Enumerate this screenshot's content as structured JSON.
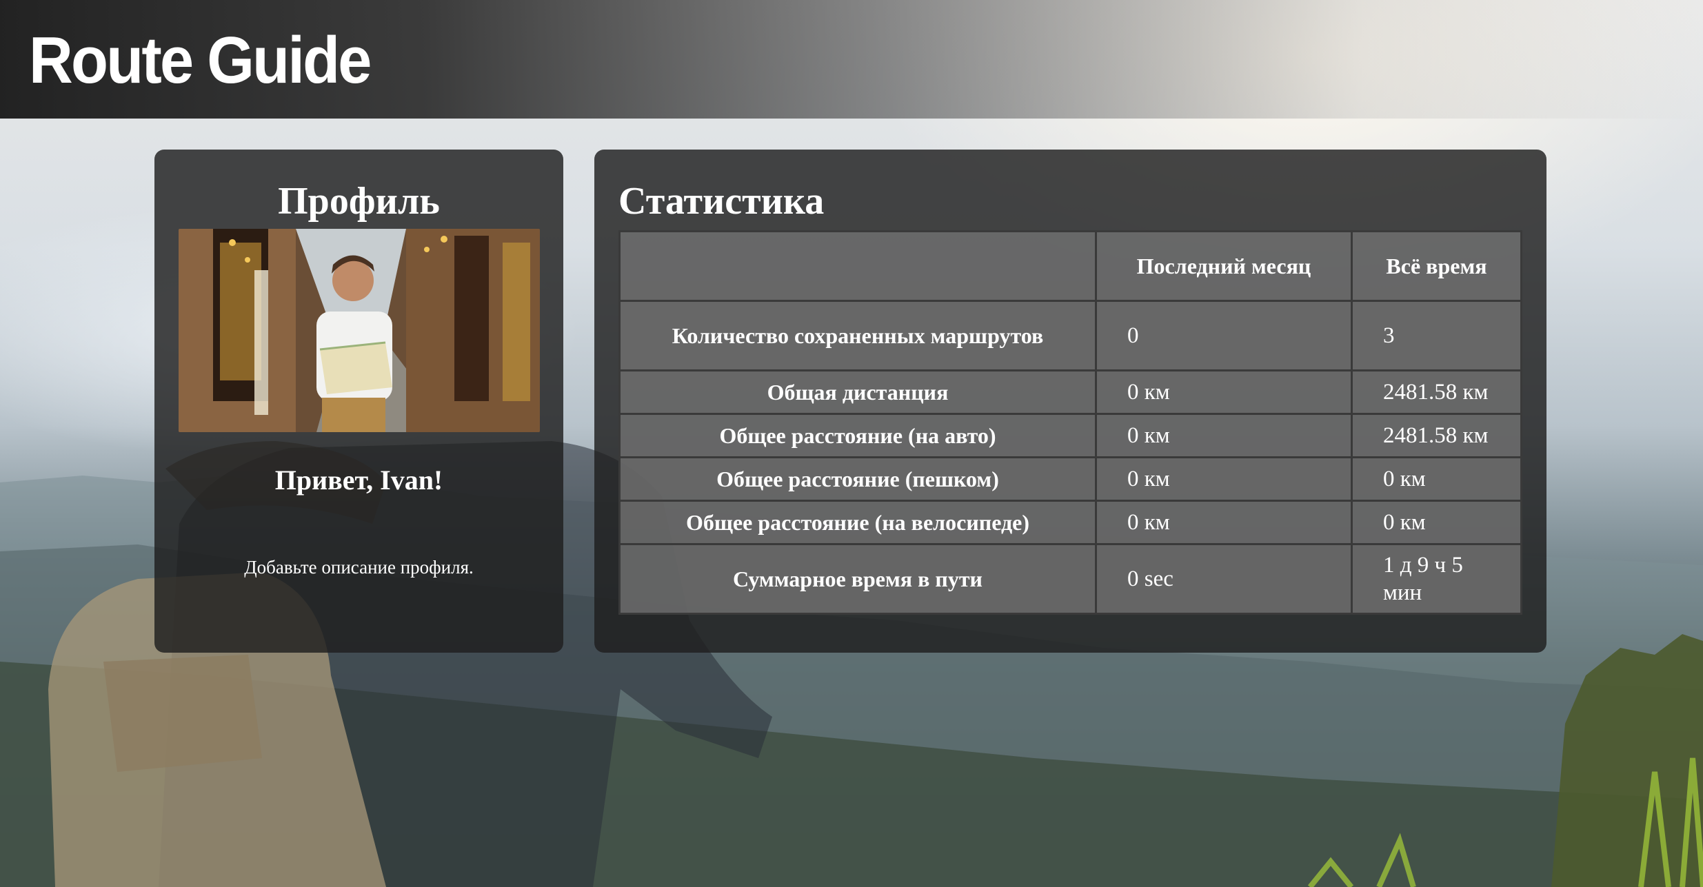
{
  "header": {
    "brand": "Route Guide"
  },
  "profile": {
    "title": "Профиль",
    "greeting": "Привет, Ivan!",
    "description": "Добавьте описание профиля."
  },
  "stats": {
    "title": "Статистика",
    "columns": [
      "",
      "Последний месяц",
      "Всё время"
    ],
    "rows": [
      {
        "label": "Количество сохраненных маршрутов",
        "last_month": "0",
        "all_time": "3"
      },
      {
        "label": "Общая дистанция",
        "last_month": "0 км",
        "all_time": "2481.58 км"
      },
      {
        "label": "Общее расстояние (на авто)",
        "last_month": "0 км",
        "all_time": "2481.58 км"
      },
      {
        "label": "Общее расстояние (пешком)",
        "last_month": "0 км",
        "all_time": "0 км"
      },
      {
        "label": "Общее расстояние (на велосипеде)",
        "last_month": "0 км",
        "all_time": "0 км"
      },
      {
        "label": "Суммарное время в пути",
        "last_month": "0 sec",
        "all_time": "1 д 9 ч 5 мин"
      }
    ]
  }
}
